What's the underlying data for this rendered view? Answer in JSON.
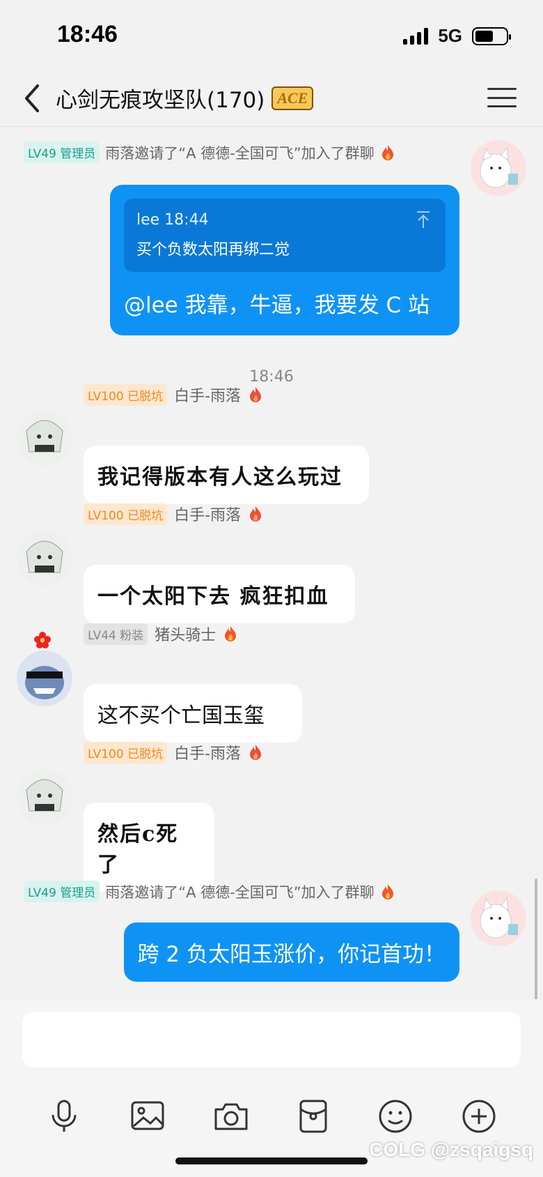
{
  "status": {
    "time": "18:46",
    "network": "5G"
  },
  "header": {
    "title": "心剑无痕攻坚队(170)",
    "badge": "ACE"
  },
  "messages": {
    "sys1": {
      "level": "LV49 管理员",
      "text": "雨落邀请了“A 德德-全国可飞”加入了群聊"
    },
    "quote": {
      "author": "lee 18:44",
      "text": "买个负数太阳再绑二觉"
    },
    "out1": "@lee 我靠，牛逼，我要发 C 站",
    "time": "18:46",
    "m1": {
      "level": "LV100 已脱坑",
      "name": "白手-雨落",
      "text": "我记得版本有人这么玩过"
    },
    "m2": {
      "level": "LV100 已脱坑",
      "name": "白手-雨落",
      "text": "一个太阳下去 疯狂扣血"
    },
    "m3": {
      "level": "LV44 粉装",
      "name": "猪头骑士",
      "text": "这不买个亡国玉玺"
    },
    "m4": {
      "level": "LV100 已脱坑",
      "name": "白手-雨落",
      "text": "然后c死了"
    },
    "sys2": {
      "level": "LV49 管理员",
      "text": "雨落邀请了“A 德德-全国可飞”加入了群聊"
    },
    "out2": "跨 2 负太阳玉涨价，你记首功！"
  },
  "watermark": "COLG @zsqaigsq",
  "colors": {
    "bubble_out": "#0e93f5",
    "quote_bg": "#0a78d6",
    "admin": "#16a08c",
    "orange": "#f08a1c"
  }
}
